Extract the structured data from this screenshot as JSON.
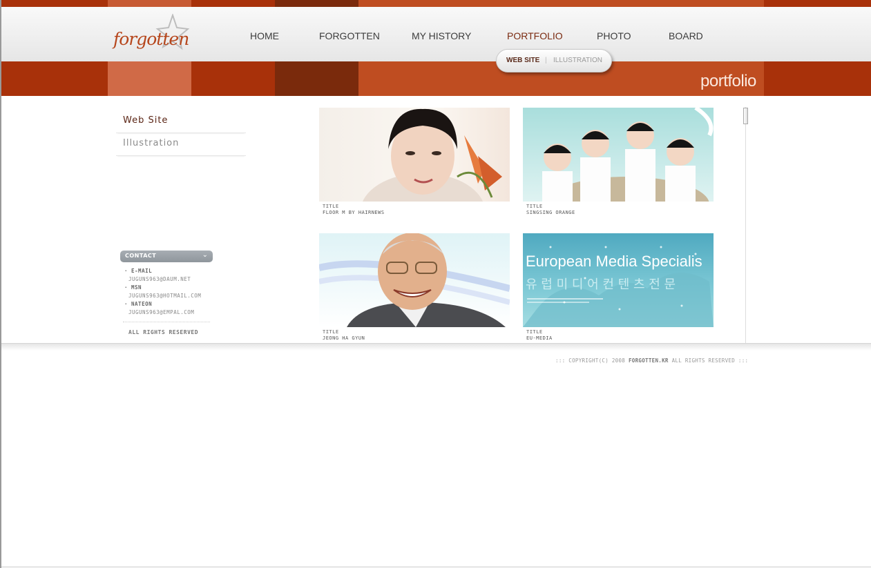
{
  "colors": {
    "band_dark": "#a8310a",
    "band_mid": "#c75a33",
    "band_light": "#d06a47",
    "band_brown": "#7a2a0c",
    "band_orange": "#bf4d21"
  },
  "logo": {
    "text": "forgotten",
    "icon": "star-icon"
  },
  "nav": {
    "items": [
      "HOME",
      "FORGOTTEN",
      "MY HISTORY",
      "PORTFOLIO",
      "PHOTO",
      "BOARD"
    ],
    "active": "PORTFOLIO"
  },
  "subnav": {
    "items": [
      "WEB SITE",
      "ILLUSTRATION"
    ],
    "separator": "|"
  },
  "section_title": "portfolio",
  "sidebar": {
    "menu": [
      "Web Site",
      "Illustration"
    ],
    "contact": {
      "title": "CONTACT",
      "chevron": "chevron-down-icon",
      "entries": [
        {
          "label": "E-MAIL",
          "value": "JUGUNS963@DAUM.NET"
        },
        {
          "label": "MSN",
          "value": "JUGUNS963@HOTMAIL.COM"
        },
        {
          "label": "NATEON",
          "value": "JUGUNS963@EMPAL.COM"
        }
      ],
      "rights": "ALL RIGHTS RESERVED"
    }
  },
  "gallery": {
    "title_label": "TITLE",
    "items": [
      {
        "title": "FLOOR M BY HAIRNEWS"
      },
      {
        "title": "SINGSING ORANGE"
      },
      {
        "title": "JEONG HA GYUN"
      },
      {
        "title": "EU-MEDIA",
        "banner": "European Media Specialis",
        "korean": "유 럽 미 디 어  컨 텐 츠 전 문"
      }
    ]
  },
  "footer": {
    "prefix": "::: COPYRIGHT(C) 2008",
    "brand": "FORGOTTEN.KR",
    "suffix": "ALL RIGHTS RESERVED :::"
  }
}
